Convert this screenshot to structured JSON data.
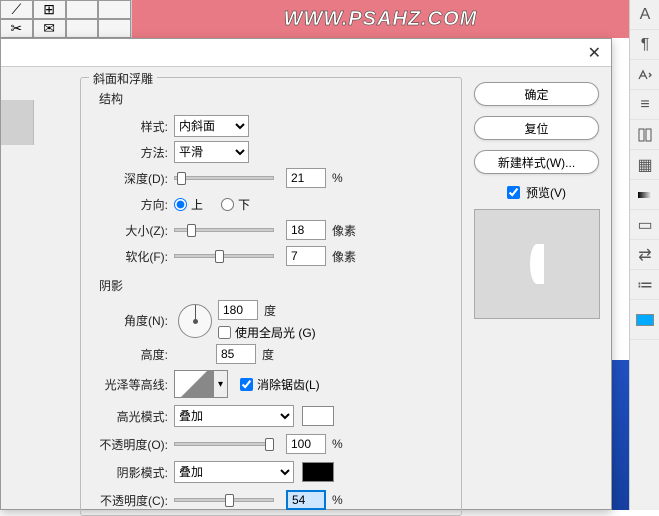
{
  "banner_text": "WWW.PSAHZ.COM",
  "dialog": {
    "title_section": "斜面和浮雕",
    "structure_label": "结构",
    "style_label": "样式:",
    "style_value": "内斜面",
    "method_label": "方法:",
    "method_value": "平滑",
    "depth_label": "深度(D):",
    "depth_value": "21",
    "pct": "%",
    "direction_label": "方向:",
    "dir_up": "上",
    "dir_down": "下",
    "size_label": "大小(Z):",
    "size_value": "18",
    "px": "像素",
    "soften_label": "软化(F):",
    "soften_value": "7",
    "shadow_label": "阴影",
    "angle_label": "角度(N):",
    "angle_value": "180",
    "deg": "度",
    "global_light": "使用全局光 (G)",
    "altitude_label": "高度:",
    "altitude_value": "85",
    "gloss_label": "光泽等高线:",
    "antialias": "消除锯齿(L)",
    "highlight_mode_label": "高光模式:",
    "highlight_mode_value": "叠加",
    "highlight_opacity_label": "不透明度(O):",
    "highlight_opacity_value": "100",
    "shadow_mode_label": "阴影模式:",
    "shadow_mode_value": "叠加",
    "shadow_opacity_label": "不透明度(C):",
    "shadow_opacity_value": "54"
  },
  "buttons": {
    "ok": "确定",
    "reset": "复位",
    "new_style": "新建样式(W)...",
    "preview": "预览(V)"
  }
}
